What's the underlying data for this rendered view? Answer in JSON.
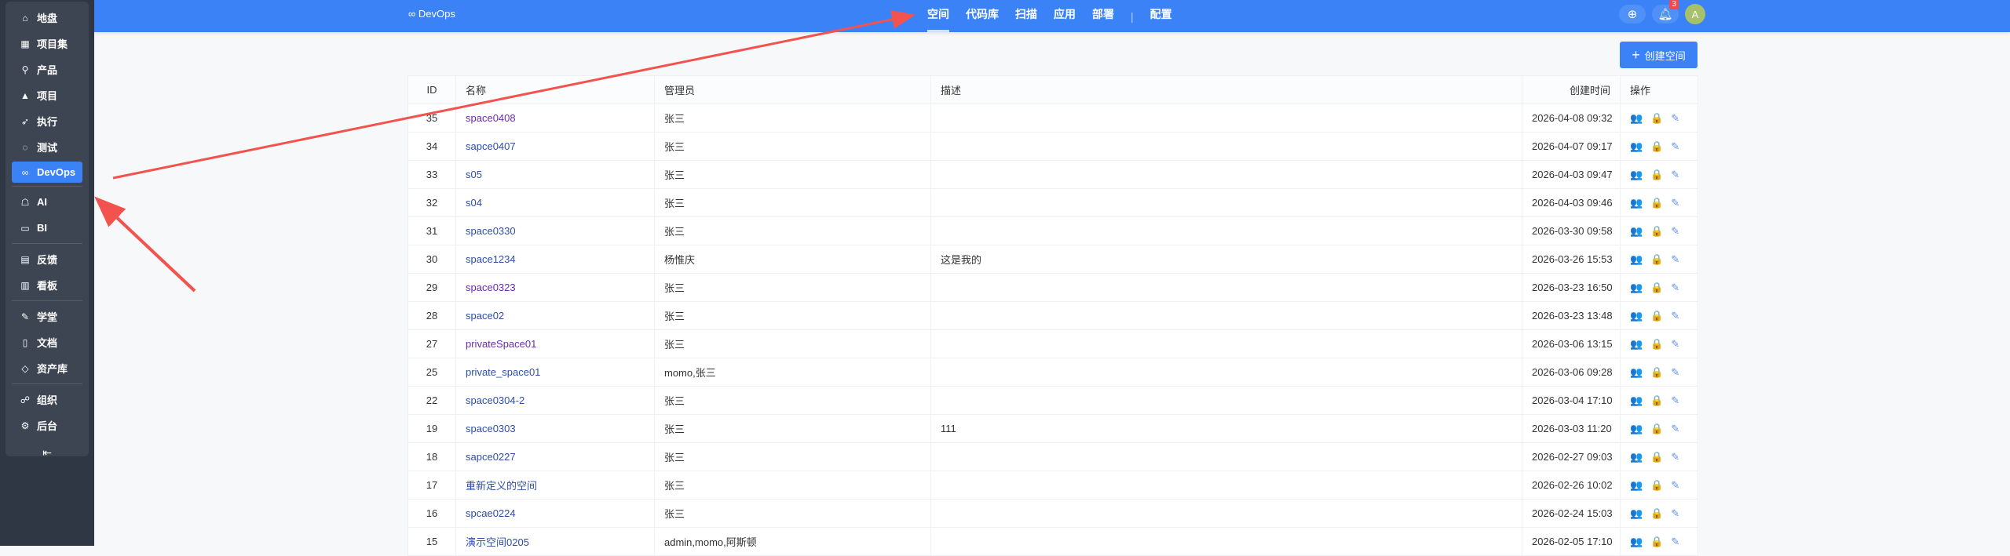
{
  "sidebar": {
    "items": [
      {
        "icon": "home-icon",
        "glyph": "⌂",
        "label": "地盘"
      },
      {
        "icon": "grid-icon",
        "glyph": "▦",
        "label": "项目集"
      },
      {
        "icon": "bulb-icon",
        "glyph": "⚲",
        "label": "产品"
      },
      {
        "icon": "rocket-icon",
        "glyph": "▲",
        "label": "项目"
      },
      {
        "icon": "run-icon",
        "glyph": "➶",
        "label": "执行"
      },
      {
        "icon": "search-icon",
        "glyph": "◌",
        "label": "测试"
      },
      {
        "icon": "infinity-icon",
        "glyph": "∞",
        "label": "DevOps",
        "active": true
      },
      {
        "icon": "robot-icon",
        "glyph": "☖",
        "label": "AI"
      },
      {
        "icon": "chart-icon",
        "glyph": "▭",
        "label": "BI"
      },
      {
        "icon": "feedback-icon",
        "glyph": "▤",
        "label": "反馈"
      },
      {
        "icon": "board-icon",
        "glyph": "▥",
        "label": "看板"
      },
      {
        "icon": "school-icon",
        "glyph": "✎",
        "label": "学堂"
      },
      {
        "icon": "document-icon",
        "glyph": "▯",
        "label": "文档"
      },
      {
        "icon": "diamond-icon",
        "glyph": "◇",
        "label": "资产库"
      },
      {
        "icon": "users-icon",
        "glyph": "☍",
        "label": "组织"
      },
      {
        "icon": "gear-icon",
        "glyph": "⚙",
        "label": "后台"
      }
    ],
    "collapse_glyph": "⇤"
  },
  "header": {
    "brand_glyph": "∞",
    "brand": "DevOps",
    "tabs": [
      "空间",
      "代码库",
      "扫描",
      "应用",
      "部署",
      "配置"
    ],
    "active_tab": "空间",
    "separator": "|",
    "notification_count": "3",
    "avatar_letter": "A",
    "accent": "#3b82f6"
  },
  "create_button": {
    "label": "创建空间",
    "glyph": "+"
  },
  "table": {
    "columns": [
      "ID",
      "名称",
      "管理员",
      "描述",
      "创建时间",
      "操作"
    ],
    "rows": [
      {
        "id": "35",
        "name": "space0408",
        "admin": "张三",
        "desc": "",
        "time": "2026-04-08 09:32",
        "visited": true
      },
      {
        "id": "34",
        "name": "sapce0407",
        "admin": "张三",
        "desc": "",
        "time": "2026-04-07 09:17"
      },
      {
        "id": "33",
        "name": "s05",
        "admin": "张三",
        "desc": "",
        "time": "2026-04-03 09:47"
      },
      {
        "id": "32",
        "name": "s04",
        "admin": "张三",
        "desc": "",
        "time": "2026-04-03 09:46"
      },
      {
        "id": "31",
        "name": "space0330",
        "admin": "张三",
        "desc": "",
        "time": "2026-03-30 09:58"
      },
      {
        "id": "30",
        "name": "space1234",
        "admin": "杨惟庆",
        "desc": "这是我的",
        "time": "2026-03-26 15:53"
      },
      {
        "id": "29",
        "name": "space0323",
        "admin": "张三",
        "desc": "",
        "time": "2026-03-23 16:50",
        "visited": true
      },
      {
        "id": "28",
        "name": "space02",
        "admin": "张三",
        "desc": "",
        "time": "2026-03-23 13:48"
      },
      {
        "id": "27",
        "name": "privateSpace01",
        "admin": "张三",
        "desc": "",
        "time": "2026-03-06 13:15",
        "visited": true
      },
      {
        "id": "25",
        "name": "private_space01",
        "admin": "momo,张三",
        "desc": "",
        "time": "2026-03-06 09:28"
      },
      {
        "id": "22",
        "name": "space0304-2",
        "admin": "张三",
        "desc": "",
        "time": "2026-03-04 17:10"
      },
      {
        "id": "19",
        "name": "space0303",
        "admin": "张三",
        "desc": "111",
        "time": "2026-03-03 11:20"
      },
      {
        "id": "18",
        "name": "sapce0227",
        "admin": "张三",
        "desc": "",
        "time": "2026-02-27 09:03"
      },
      {
        "id": "17",
        "name": "重新定义的空间",
        "admin": "张三",
        "desc": "",
        "time": "2026-02-26 10:02"
      },
      {
        "id": "16",
        "name": "spcae0224",
        "admin": "张三",
        "desc": "",
        "time": "2026-02-24 15:03"
      },
      {
        "id": "15",
        "name": "演示空间0205",
        "admin": "admin,momo,阿斯顿",
        "desc": "",
        "time": "2026-02-05 17:10"
      }
    ],
    "row_actions": [
      {
        "icon": "members-icon",
        "glyph": "👥"
      },
      {
        "icon": "lock-icon",
        "glyph": "🔒"
      },
      {
        "icon": "edit-icon",
        "glyph": "✎"
      }
    ]
  },
  "annotation_color": "#f2534f"
}
